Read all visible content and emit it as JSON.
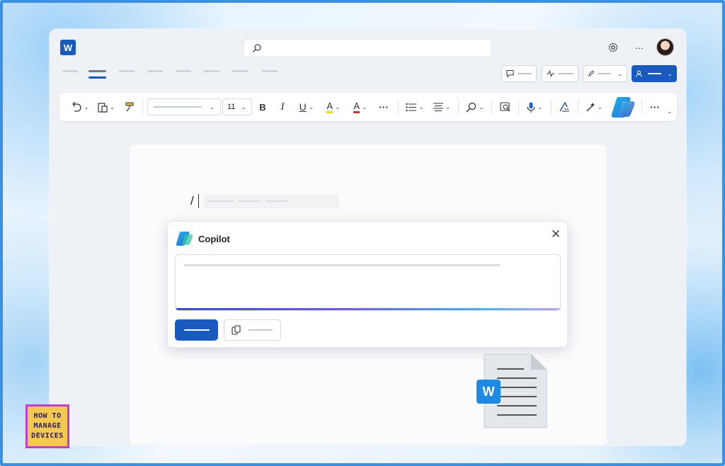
{
  "app": {
    "logo_letter": "W"
  },
  "ribbon": {
    "font_size": "11",
    "bold": "B",
    "italic": "I",
    "underline": "U",
    "highlight": "A",
    "font_color": "A",
    "more": "···"
  },
  "copilot": {
    "title": "Copilot"
  },
  "illustration": {
    "badge_letter": "W"
  },
  "brand": {
    "line1": "HOW TO",
    "line2": "MANAGE",
    "line3": "DEVICES"
  },
  "colors": {
    "accent": "#185abd",
    "frame_border": "#3d8fe0"
  },
  "icons": [
    "search-icon",
    "settings-icon",
    "more-icon",
    "comment-icon",
    "activity-icon",
    "edit-icon",
    "share-icon",
    "undo-icon",
    "paste-icon",
    "format-painter-icon",
    "list-icon",
    "align-icon",
    "find-icon",
    "editor-icon",
    "dictate-icon",
    "styles-icon",
    "designer-icon",
    "copilot-icon",
    "close-icon",
    "reference-icon"
  ]
}
